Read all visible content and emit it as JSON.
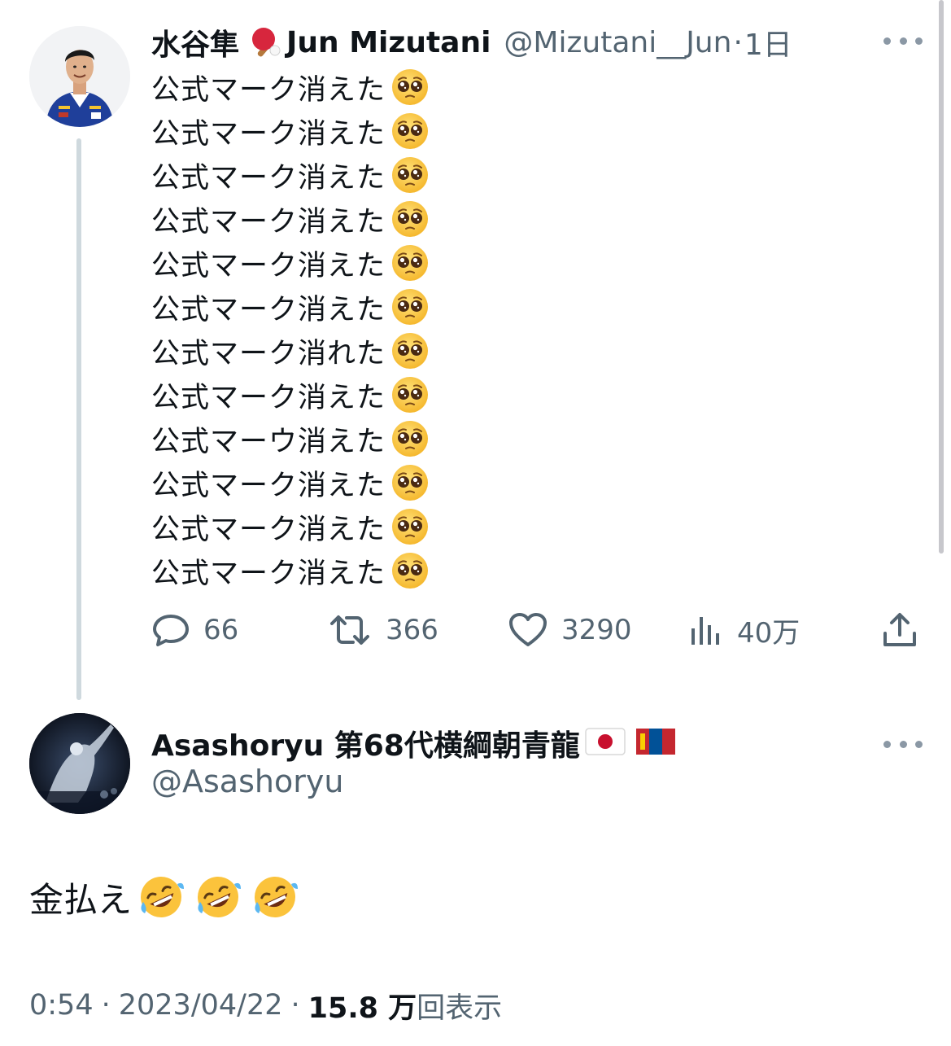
{
  "tweet1": {
    "author_name": "水谷隼",
    "author_name_suffix": "Jun Mizutani",
    "handle": "@Mizutani__Jun",
    "separator": "·",
    "time": "1日",
    "lines": [
      "公式マーク消えた",
      "公式マーク消えた",
      "公式マーク消えた",
      "公式マーク消えた",
      "公式マーク消えた",
      "公式マーク消えた",
      "公式マーク消れた",
      "公式マーク消えた",
      "公式マーウ消えた",
      "公式マーク消えた",
      "公式マーク消えた",
      "公式マーク消えた"
    ],
    "line_emoji": "pleading-face-emoji",
    "name_emoji": "ping-pong-emoji",
    "actions": {
      "replies": "66",
      "retweets": "366",
      "likes": "3290",
      "views": "40万"
    }
  },
  "tweet2": {
    "author_name": "Asashoryu 第68代横綱朝青龍",
    "flags": [
      "japan-flag-icon",
      "mongolia-flag-icon"
    ],
    "handle": "@Asashoryu",
    "text": "金払え",
    "text_emoji": "rolling-on-floor-laughing-emoji",
    "emoji_count": 3,
    "time": "0:54",
    "date": "2023/04/22",
    "views_count": "15.8 万",
    "views_label": "回表示",
    "separator": "·"
  },
  "colors": {
    "text": "#0f1419",
    "secondary": "#536471",
    "thread_line": "#cfd9de"
  }
}
